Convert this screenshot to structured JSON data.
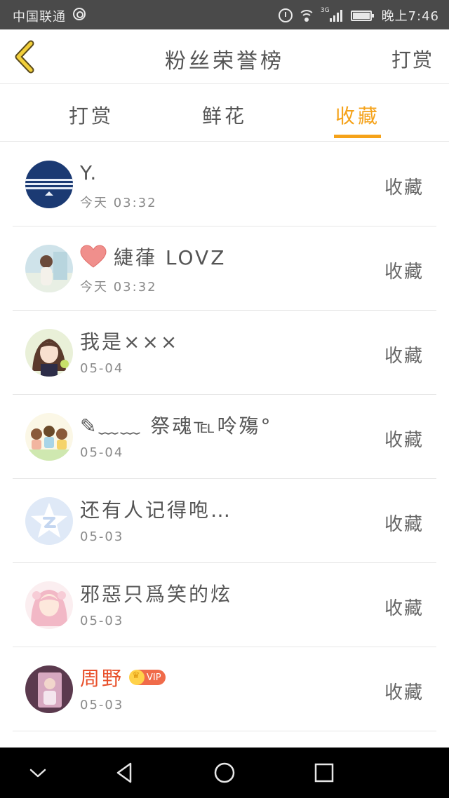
{
  "status_bar": {
    "carrier": "中国联通",
    "network": "3G",
    "time": "晚上7:46"
  },
  "header": {
    "title": "粉丝荣誉榜",
    "action_label": "打赏"
  },
  "tabs": [
    {
      "label": "打赏",
      "active": false
    },
    {
      "label": "鲜花",
      "active": false
    },
    {
      "label": "收藏",
      "active": true
    }
  ],
  "colors": {
    "accent": "#f5a219",
    "vip_name": "#e8502b",
    "status_bar_bg": "#4a4a4a",
    "nav_bar_bg": "#000000"
  },
  "list": [
    {
      "name": "Y.",
      "time": "今天 03:32",
      "action": "收藏",
      "avatar": "navy-stripes-avatar"
    },
    {
      "name": "緁葎 LOVZ",
      "time": "今天 03:32",
      "action": "收藏",
      "avatar": "girl-photo-avatar",
      "has_heart": true
    },
    {
      "name": "我是×××",
      "time": "05-04",
      "action": "收藏",
      "avatar": "anime-girl-avatar"
    },
    {
      "name": "✎﹏﹏ 祭魂℡呤殤°",
      "time": "05-04",
      "action": "收藏",
      "avatar": "cartoon-kids-avatar"
    },
    {
      "name": "还有人记得咆…",
      "time": "05-03",
      "action": "收藏",
      "avatar": "default-star-avatar"
    },
    {
      "name": "邪惡只爲笑的炫",
      "time": "05-03",
      "action": "收藏",
      "avatar": "pink-anime-avatar"
    },
    {
      "name": "周野",
      "time": "05-03",
      "action": "收藏",
      "avatar": "portrait-photo-avatar",
      "vip": true,
      "vip_label": "VIP"
    }
  ]
}
